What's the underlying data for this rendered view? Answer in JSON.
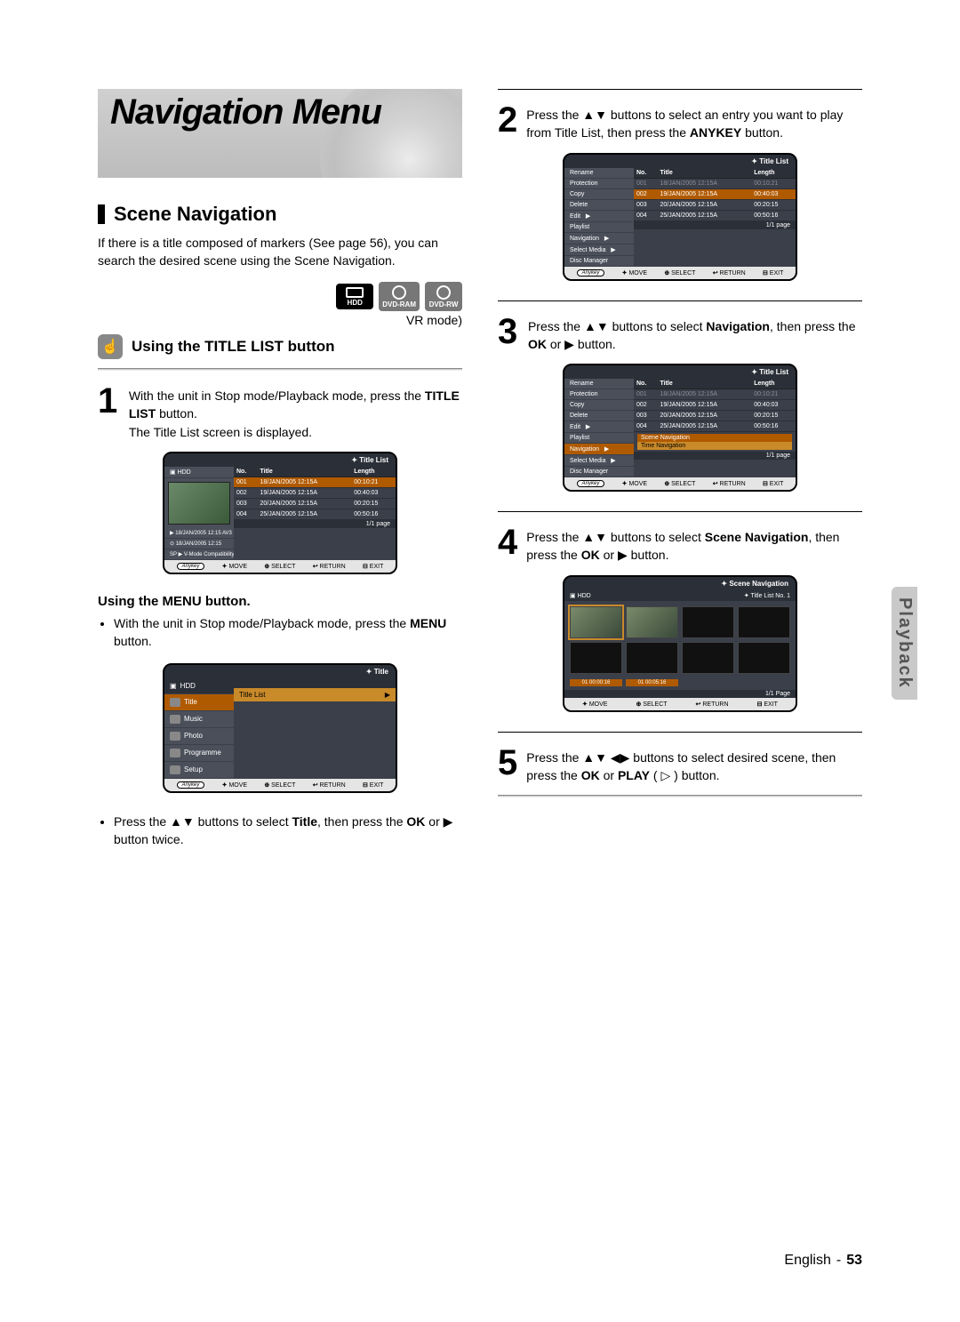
{
  "banner_title": "Navigation Menu",
  "section_title": "Scene Navigation",
  "section_blurb": "If there is a title composed of markers (See page 56), you can search the desired scene using the Scene Navigation.",
  "media_badges": [
    "HDD",
    "DVD-RAM",
    "DVD-RW"
  ],
  "vr_mode_label": "VR mode)",
  "using_title_list": "Using the TITLE LIST button",
  "step1": {
    "num": "1",
    "pre": "With the unit in Stop mode/Playback mode, press the ",
    "bold": "TITLE LIST",
    "post": " button.",
    "line2": "The Title List screen is displayed."
  },
  "using_menu_head": "Using the MENU button.",
  "using_menu_bullet_pre": "With the unit in Stop mode/Playback mode, press the ",
  "using_menu_bullet_bold": "MENU",
  "using_menu_bullet_post": " button.",
  "after_menu_bullet_pre": "Press the ",
  "after_menu_arrows": "▲▼",
  "after_menu_bullet_mid1": " buttons to select ",
  "after_menu_bold1": "Title",
  "after_menu_bullet_mid2": ", then press the ",
  "after_menu_bold2": "OK",
  "after_menu_bullet_mid3": " or ",
  "after_menu_play": "▶",
  "after_menu_bullet_end": " button twice.",
  "step2": {
    "num": "2",
    "pre": "Press the ",
    "arrows": "▲▼",
    "mid1": " buttons to select an entry you want to play from Title List, then press the ",
    "bold": "ANYKEY",
    "post": " button."
  },
  "step3": {
    "num": "3",
    "pre": "Press the ",
    "arrows": "▲▼",
    "mid1": " buttons to select ",
    "bold1": "Navigation",
    "mid2": ", then press the ",
    "bold2": "OK",
    "mid3": " or ",
    "play": "▶",
    "post": " button."
  },
  "step4": {
    "num": "4",
    "pre": "Press the ",
    "arrows": "▲▼",
    "mid1": " buttons to select ",
    "bold1": "Scene Navigation",
    "mid2": ", then press the ",
    "bold2": "OK",
    "mid3": " or ",
    "play": "▶",
    "post": " button."
  },
  "step5": {
    "num": "5",
    "pre": "Press the ",
    "arrows": "▲▼ ◀▶",
    "mid1": " buttons to select desired scene, then press the ",
    "bold1": "OK",
    "mid2": " or ",
    "bold2": "PLAY",
    "play_glyph": " ( ▷ ) ",
    "post": "button."
  },
  "osd": {
    "title_list_label": "Title List",
    "title_label": "Title",
    "scene_nav_label": "Scene Navigation",
    "anykey": "Anykey",
    "footer_move": "MOVE",
    "footer_select": "SELECT",
    "footer_return": "RETURN",
    "footer_exit": "EXIT",
    "footer_move_glyph": "✦",
    "footer_select_glyph": "⊕",
    "footer_return_glyph": "↩",
    "footer_exit_glyph": "⊟",
    "pager": "1/1 page",
    "pager2": "1/1 Page",
    "hdd": "HDD",
    "title_list_no": "Title List No. 1",
    "columns": {
      "no": "No.",
      "title": "Title",
      "length": "Length"
    },
    "rows": [
      {
        "no": "001",
        "title": "18/JAN/2005 12:15A",
        "len": "00:10:21"
      },
      {
        "no": "002",
        "title": "19/JAN/2005 12:15A",
        "len": "00:40:03"
      },
      {
        "no": "003",
        "title": "20/JAN/2005 12:15A",
        "len": "00:20:15"
      },
      {
        "no": "004",
        "title": "25/JAN/2005 12:15A",
        "len": "00:50:16"
      }
    ],
    "left_info": [
      "18/JAN/2005 12:15 AV3",
      "18/JAN/2005 12:15",
      "SP ▶ V-Mode Compatibility"
    ],
    "context_menu": [
      "Rename",
      "Protection",
      "Copy",
      "Delete",
      "Edit",
      "Playlist",
      "Navigation",
      "Select Media",
      "Disc Manager"
    ],
    "nav_submenu": [
      "Scene Navigation",
      "Time Navigation"
    ],
    "title_menu": {
      "device": "HDD",
      "items": [
        "Title",
        "Music",
        "Photo",
        "Programme",
        "Setup"
      ],
      "right_label": "Title List",
      "right_arrow": "▶"
    },
    "scene_cells": [
      {
        "label": "01  00:00:16",
        "filled": true
      },
      {
        "label": "01  00:05:16",
        "filled": true
      },
      {
        "label": "",
        "filled": false
      },
      {
        "label": "",
        "filled": false
      }
    ]
  },
  "side_tab": "Playback",
  "footer_lang": "English",
  "footer_sep": "-",
  "footer_page": "53"
}
